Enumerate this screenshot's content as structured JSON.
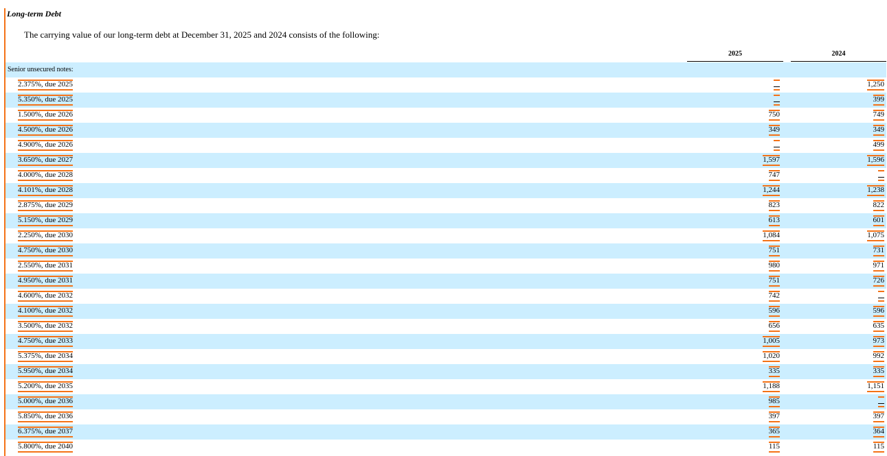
{
  "section": {
    "title": "Long-term Debt",
    "intro": "The carrying value of our long-term debt at December 31, 2025 and 2024 consists of the following:"
  },
  "columns": [
    "2025",
    "2024"
  ],
  "group_label": "Senior unsecured notes:",
  "rows": [
    {
      "label": "2.375%, due 2025",
      "v2025": "—",
      "v2024": "1,250"
    },
    {
      "label": "5.350%, due 2025",
      "v2025": "—",
      "v2024": "399"
    },
    {
      "label": "1.500%, due 2026",
      "v2025": "750",
      "v2024": "749"
    },
    {
      "label": "4.500%, due 2026",
      "v2025": "349",
      "v2024": "349"
    },
    {
      "label": "4.900%, due 2026",
      "v2025": "—",
      "v2024": "499"
    },
    {
      "label": "3.650%, due 2027",
      "v2025": "1,597",
      "v2024": "1,596"
    },
    {
      "label": "4.000%, due 2028",
      "v2025": "747",
      "v2024": "—"
    },
    {
      "label": "4.101%, due 2028",
      "v2025": "1,244",
      "v2024": "1,238"
    },
    {
      "label": "2.875%, due 2029",
      "v2025": "823",
      "v2024": "822"
    },
    {
      "label": "5.150%, due 2029",
      "v2025": "613",
      "v2024": "601"
    },
    {
      "label": "2.250%, due 2030",
      "v2025": "1,084",
      "v2024": "1,075"
    },
    {
      "label": "4.750%, due 2030",
      "v2025": "751",
      "v2024": "731"
    },
    {
      "label": "2.550%, due 2031",
      "v2025": "980",
      "v2024": "971"
    },
    {
      "label": "4.950%, due 2031",
      "v2025": "751",
      "v2024": "726"
    },
    {
      "label": "4.600%, due 2032",
      "v2025": "742",
      "v2024": "—"
    },
    {
      "label": "4.100%, due 2032",
      "v2025": "596",
      "v2024": "596"
    },
    {
      "label": "3.500%, due 2032",
      "v2025": "656",
      "v2024": "635"
    },
    {
      "label": "4.750%, due 2033",
      "v2025": "1,005",
      "v2024": "973"
    },
    {
      "label": "5.375%, due 2034",
      "v2025": "1,020",
      "v2024": "992"
    },
    {
      "label": "5.950%, due 2034",
      "v2025": "335",
      "v2024": "335"
    },
    {
      "label": "5.200%, due 2035",
      "v2025": "1,188",
      "v2024": "1,151"
    },
    {
      "label": "5.000%, due 2036",
      "v2025": "985",
      "v2024": "—"
    },
    {
      "label": "5.850%, due 2036",
      "v2025": "397",
      "v2024": "397"
    },
    {
      "label": "6.375%, due 2037",
      "v2025": "365",
      "v2024": "364"
    },
    {
      "label": "5.800%, due 2040",
      "v2025": "115",
      "v2024": "115"
    }
  ],
  "colors": {
    "accent": "#f47216",
    "band": "#cceeff"
  }
}
